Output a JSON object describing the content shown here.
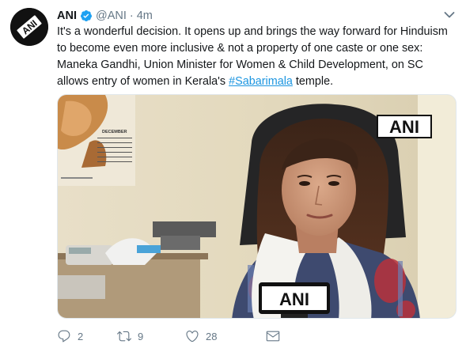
{
  "author": {
    "name": "ANI",
    "handle": "@ANI",
    "separator": "·",
    "time": "4m",
    "avatar_text": "ANI"
  },
  "tweet": {
    "text_before": "It's a wonderful decision. It opens up and brings the way forward for Hinduism to become even more inclusive & not a property of one caste or one sex: Maneka Gandhi, Union Minister for Women & Child Development, on SC allows entry of women in Kerala's ",
    "hashtag": "#Sabarimala",
    "text_after": " temple."
  },
  "media": {
    "watermark": "ANI",
    "mic_logo": "ANI",
    "calendar_month": "DECEMBER"
  },
  "actions": {
    "replies": "2",
    "retweets": "9",
    "likes": "28"
  },
  "colors": {
    "link": "#1b95e0",
    "verified": "#1da1f2",
    "meta": "#657786"
  }
}
